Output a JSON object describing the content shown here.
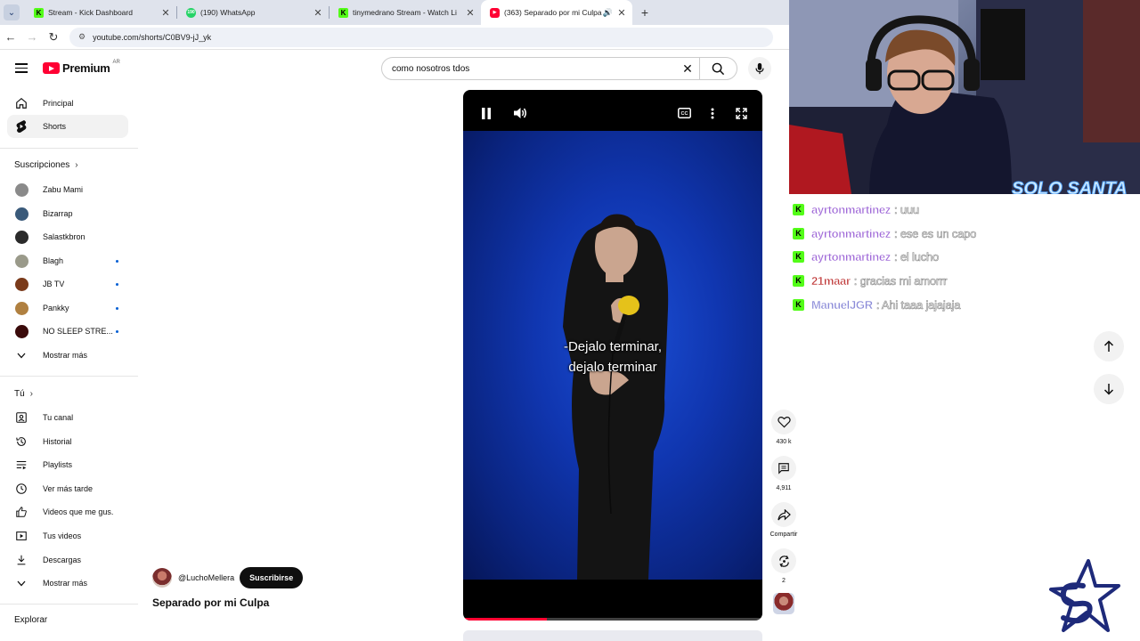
{
  "browser": {
    "tabs": [
      {
        "label": "Stream - Kick Dashboard",
        "favicon": "kick-icon"
      },
      {
        "label": "(190) WhatsApp",
        "favicon": "whatsapp-icon"
      },
      {
        "label": "tinymedrano Stream - Watch Li",
        "favicon": "kick-icon"
      },
      {
        "label": "(363) Separado por mi Culpa",
        "favicon": "youtube-icon",
        "active": true
      }
    ],
    "url": "youtube.com/shorts/C0BV9-jJ_yk"
  },
  "header": {
    "logo_text": "Premium",
    "country": "AR",
    "search_value": "como nosotros tdos"
  },
  "sidebar": {
    "main": [
      {
        "label": "Principal",
        "icon": "home-icon"
      },
      {
        "label": "Shorts",
        "icon": "shorts-icon",
        "active": true
      }
    ],
    "subs_heading": "Suscripciones",
    "subs": [
      {
        "label": "Zabu Mami",
        "color": "#8a8a8a",
        "dot": false
      },
      {
        "label": "Bizarrap",
        "color": "#3a5a7a",
        "dot": false
      },
      {
        "label": "Salastkbron",
        "color": "#2a2a2a",
        "dot": false
      },
      {
        "label": "Blagh",
        "color": "#9a9a8a",
        "dot": true
      },
      {
        "label": "JB TV",
        "color": "#7a3a1a",
        "dot": true
      },
      {
        "label": "Pankky",
        "color": "#b08040",
        "dot": true
      },
      {
        "label": "NO SLEEP STRE...",
        "color": "#3a0a0a",
        "dot": true
      }
    ],
    "subs_more": "Mostrar más",
    "you_heading": "Tú",
    "you": [
      {
        "label": "Tu canal",
        "icon": "channel-icon"
      },
      {
        "label": "Historial",
        "icon": "history-icon"
      },
      {
        "label": "Playlists",
        "icon": "playlist-icon"
      },
      {
        "label": "Ver más tarde",
        "icon": "clock-icon"
      },
      {
        "label": "Videos que me gus...",
        "icon": "thumb-up-icon"
      },
      {
        "label": "Tus videos",
        "icon": "video-icon"
      },
      {
        "label": "Descargas",
        "icon": "download-icon"
      }
    ],
    "you_more": "Mostrar más",
    "explore_heading": "Explorar"
  },
  "short": {
    "channel": "@LuchoMellera",
    "subscribe_label": "Suscribirse",
    "title": "Separado por mi Culpa",
    "caption_line1": "-Dejalo terminar,",
    "caption_line2": "dejalo terminar",
    "progress": 0.28,
    "likes": "430 k",
    "comments": "4,911",
    "share_label": "Compartir",
    "remix_count": "2"
  },
  "chat": [
    {
      "user": "ayrtonmartinez",
      "msg": ": uuu",
      "color": "#a06ad8"
    },
    {
      "user": "ayrtonmartinez",
      "msg": ": ese es un capo",
      "color": "#a06ad8"
    },
    {
      "user": "ayrtonmartinez",
      "msg": ": el lucho",
      "color": "#a06ad8"
    },
    {
      "user": "21maar",
      "msg": ": gracias mi amorrr",
      "color": "#c03a3a"
    },
    {
      "user": "ManuelJGR",
      "msg": ": Ahi taaa jajajaja",
      "color": "#8a8ad8"
    }
  ],
  "overlay_logo": "SOLO SANTA"
}
